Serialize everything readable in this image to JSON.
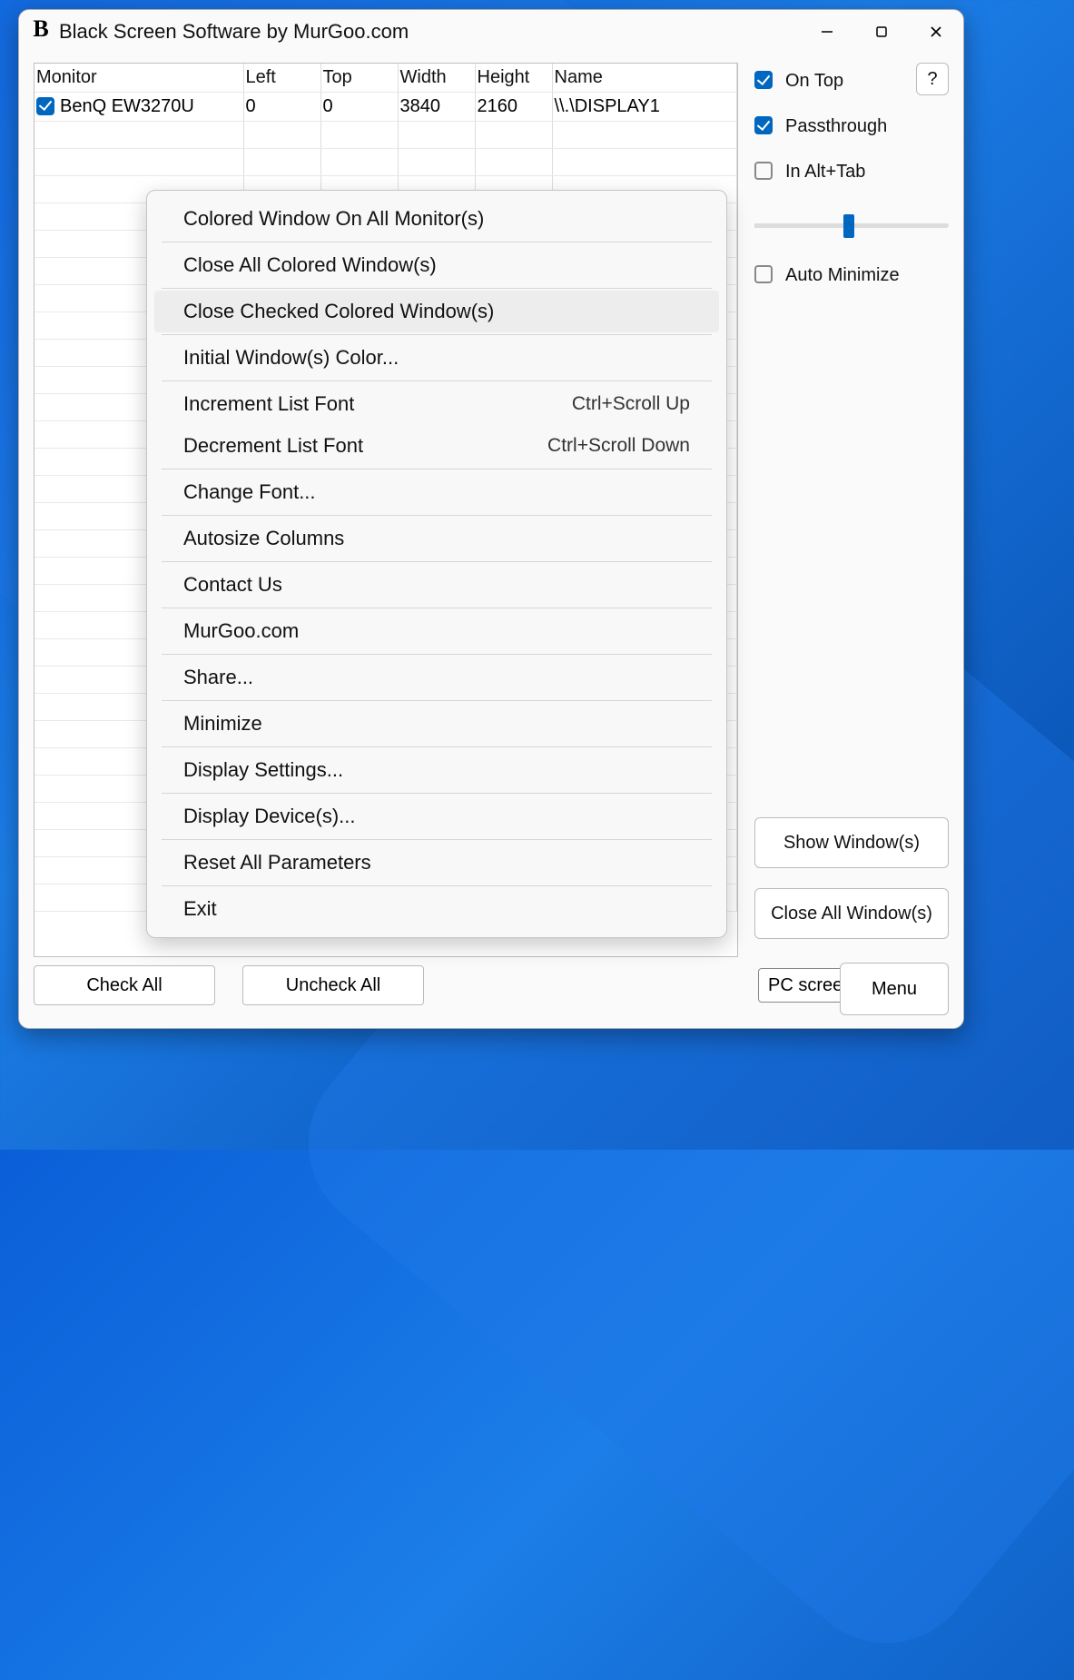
{
  "title": "Black Screen Software by MurGoo.com",
  "table": {
    "headers": [
      "Monitor",
      "Left",
      "Top",
      "Width",
      "Height",
      "Name"
    ],
    "row": {
      "checked": true,
      "monitor": "BenQ EW3270U",
      "left": "0",
      "top": "0",
      "width": "3840",
      "height": "2160",
      "name": "\\\\.\\DISPLAY1"
    }
  },
  "options": {
    "on_top": {
      "label": "On Top",
      "checked": true
    },
    "passthrough": {
      "label": "Passthrough",
      "checked": true
    },
    "in_alt_tab": {
      "label": "In Alt+Tab",
      "checked": false
    },
    "auto_minimize": {
      "label": "Auto Minimize",
      "checked": false
    },
    "help": "?"
  },
  "slider_value_pct": 46,
  "buttons": {
    "show_windows": "Show Window(s)",
    "close_all_windows": "Close All Window(s)",
    "check_all": "Check All",
    "uncheck_all": "Uncheck All",
    "menu": "Menu"
  },
  "dropdown": {
    "selected": "PC screen only"
  },
  "context_menu": [
    {
      "label": "Colored Window On All Monitor(s)"
    },
    {
      "sep": true
    },
    {
      "label": "Close All Colored Window(s)"
    },
    {
      "sep": true
    },
    {
      "label": "Close Checked Colored Window(s)",
      "hover": true
    },
    {
      "sep": true
    },
    {
      "label": "Initial Window(s) Color..."
    },
    {
      "sep": true
    },
    {
      "label": "Increment List Font",
      "shortcut": "Ctrl+Scroll Up"
    },
    {
      "label": "Decrement List Font",
      "shortcut": "Ctrl+Scroll Down"
    },
    {
      "sep": true
    },
    {
      "label": "Change Font..."
    },
    {
      "sep": true
    },
    {
      "label": "Autosize Columns"
    },
    {
      "sep": true
    },
    {
      "label": "Contact Us"
    },
    {
      "sep": true
    },
    {
      "label": "MurGoo.com"
    },
    {
      "sep": true
    },
    {
      "label": "Share..."
    },
    {
      "sep": true
    },
    {
      "label": "Minimize"
    },
    {
      "sep": true
    },
    {
      "label": "Display Settings..."
    },
    {
      "sep": true
    },
    {
      "label": "Display Device(s)..."
    },
    {
      "sep": true
    },
    {
      "label": "Reset All Parameters"
    },
    {
      "sep": true
    },
    {
      "label": "Exit"
    }
  ]
}
